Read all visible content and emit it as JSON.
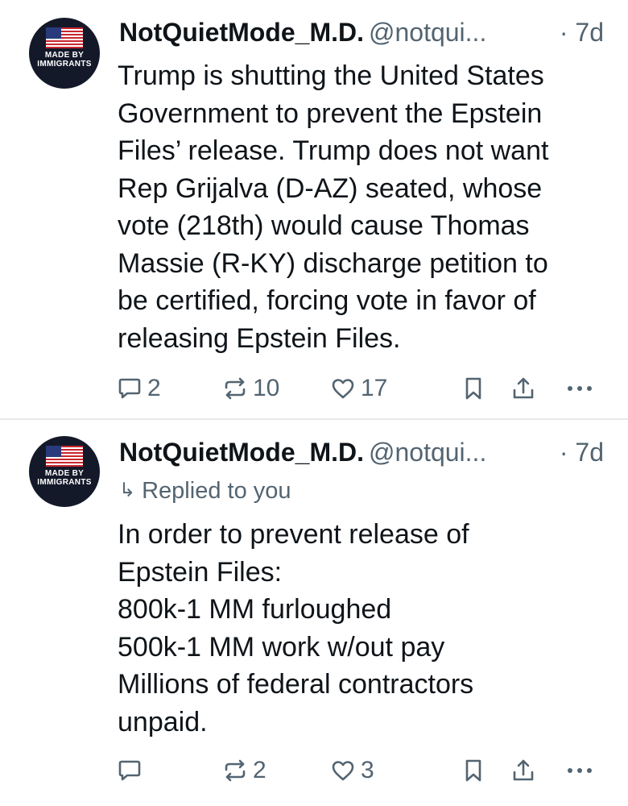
{
  "posts": [
    {
      "avatar": {
        "line1": "MADE BY",
        "line2": "IMMIGRANTS"
      },
      "display_name": "NotQuietMode_M.D.",
      "handle": "@notqui...",
      "time": "· 7d",
      "body_lines": [
        "Trump is shutting the United States",
        "Government to prevent the Epstein",
        "Files’ release. Trump does not want",
        "Rep Grijalva (D-AZ) seated, whose",
        "vote (218th) would cause Thomas",
        "Massie (R-KY) discharge petition to",
        "be certified, forcing vote in favor of",
        "releasing Epstein Files."
      ],
      "actions": {
        "replies": "2",
        "reposts": "10",
        "likes": "17"
      }
    },
    {
      "avatar": {
        "line1": "MADE BY",
        "line2": "IMMIGRANTS"
      },
      "display_name": "NotQuietMode_M.D.",
      "handle": "@notqui...",
      "time": "· 7d",
      "reply_context": "Replied to you",
      "body_lines": [
        "In order to prevent release of",
        "Epstein Files:",
        "800k-1 MM furloughed",
        "500k-1 MM work w/out pay",
        "Millions of federal contractors",
        "unpaid."
      ],
      "actions": {
        "replies": "",
        "reposts": "2",
        "likes": "3"
      }
    }
  ],
  "icons": {
    "reply": "speech-bubble-icon",
    "repost": "repost-arrows-icon",
    "like": "heart-icon",
    "bookmark": "bookmark-icon",
    "share": "share-upload-icon",
    "more": "ellipsis-icon"
  },
  "colors": {
    "text": "#0f1419",
    "secondary": "#536471",
    "divider": "#e6e9ec"
  }
}
